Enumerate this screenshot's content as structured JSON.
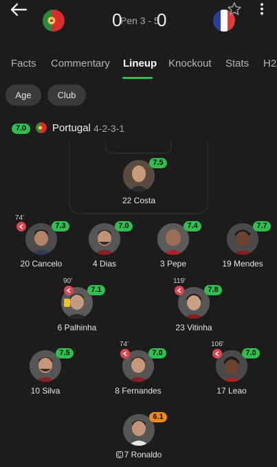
{
  "header": {
    "home_score": "0",
    "away_score": "0",
    "penalties": "Pen 3 - 5",
    "home_flag": "portugal-flag",
    "away_flag": "france-flag"
  },
  "tabs": [
    {
      "label": "Facts",
      "active": false
    },
    {
      "label": "Commentary",
      "active": false
    },
    {
      "label": "Lineup",
      "active": true
    },
    {
      "label": "Knockout",
      "active": false
    },
    {
      "label": "Stats",
      "active": false
    },
    {
      "label": "H2",
      "active": false
    }
  ],
  "filters": {
    "age": "Age",
    "club": "Club"
  },
  "team": {
    "rating": "7.0",
    "name": "Portugal",
    "formation": "4-2-3-1"
  },
  "players": [
    {
      "number": "22",
      "name": "Costa",
      "label": "22 Costa",
      "rating": "7.5"
    },
    {
      "number": "20",
      "name": "Cancelo",
      "label": "20 Cancelo",
      "rating": "7.3",
      "sub_minute": "74'"
    },
    {
      "number": "4",
      "name": "Dias",
      "label": "4 Dias",
      "rating": "7.0"
    },
    {
      "number": "3",
      "name": "Pepe",
      "label": "3 Pepe",
      "rating": "7.4"
    },
    {
      "number": "19",
      "name": "Mendes",
      "label": "19 Mendes",
      "rating": "7.7"
    },
    {
      "number": "6",
      "name": "Palhinha",
      "label": "6 Palhinha",
      "rating": "7.1",
      "sub_minute": "90'",
      "yellow_card": true
    },
    {
      "number": "23",
      "name": "Vitinha",
      "label": "23 Vitinha",
      "rating": "7.8",
      "sub_minute": "119'"
    },
    {
      "number": "10",
      "name": "Silva",
      "label": "10 Silva",
      "rating": "7.5"
    },
    {
      "number": "8",
      "name": "Fernandes",
      "label": "8 Fernandes",
      "rating": "7.0",
      "sub_minute": "74'"
    },
    {
      "number": "17",
      "name": "Leao",
      "label": "17 Leao",
      "rating": "7.0",
      "sub_minute": "106'"
    },
    {
      "number": "7",
      "name": "Ronaldo",
      "label": "7 Ronaldo",
      "rating": "6.1",
      "captain": true
    }
  ],
  "colors": {
    "accent": "#2fbf4f",
    "rating_low": "#f08a1c",
    "sub": "#e0454c",
    "yellow_card": "#f4c21a",
    "background": "#1c1c1c"
  }
}
